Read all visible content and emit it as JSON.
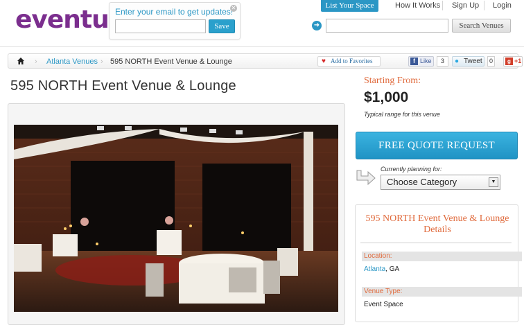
{
  "header": {
    "logo_text": "eventup",
    "email_signup": {
      "prompt": "Enter your email to get updates!",
      "input_value": "",
      "save_label": "Save"
    },
    "list_space_label": "List Your Space",
    "nav": [
      "How It Works",
      "Sign Up",
      "Login"
    ],
    "search": {
      "input_value": "",
      "button_label": "Search Venues"
    }
  },
  "breadcrumb": {
    "home_icon": "home-icon",
    "link": "Atlanta Venues",
    "current": "595 NORTH Event Venue & Lounge"
  },
  "social": {
    "favorites_label": "Add to Favorites",
    "like_label": "Like",
    "like_count": "3",
    "tweet_label": "Tweet",
    "tweet_count": "0",
    "gplus_label": "+1"
  },
  "venue": {
    "title": "595 NORTH Event Venue & Lounge"
  },
  "pricing": {
    "starting_label": "Starting From:",
    "price": "$1,000",
    "note": "Typical range for this venue"
  },
  "quote": {
    "button_label": "FREE QUOTE REQUEST",
    "planning_label": "Currently planning for:",
    "category_selected": "Choose Category"
  },
  "details": {
    "title": "595 NORTH Event Venue & Lounge Details",
    "location_label": "Location:",
    "location_city": "Atlanta",
    "location_state": ", GA",
    "type_label": "Venue Type:",
    "type_value": "Event Space"
  },
  "colors": {
    "brand_purple": "#7b2e8e",
    "accent_blue": "#2b97c5",
    "accent_orange": "#e06a3c"
  }
}
